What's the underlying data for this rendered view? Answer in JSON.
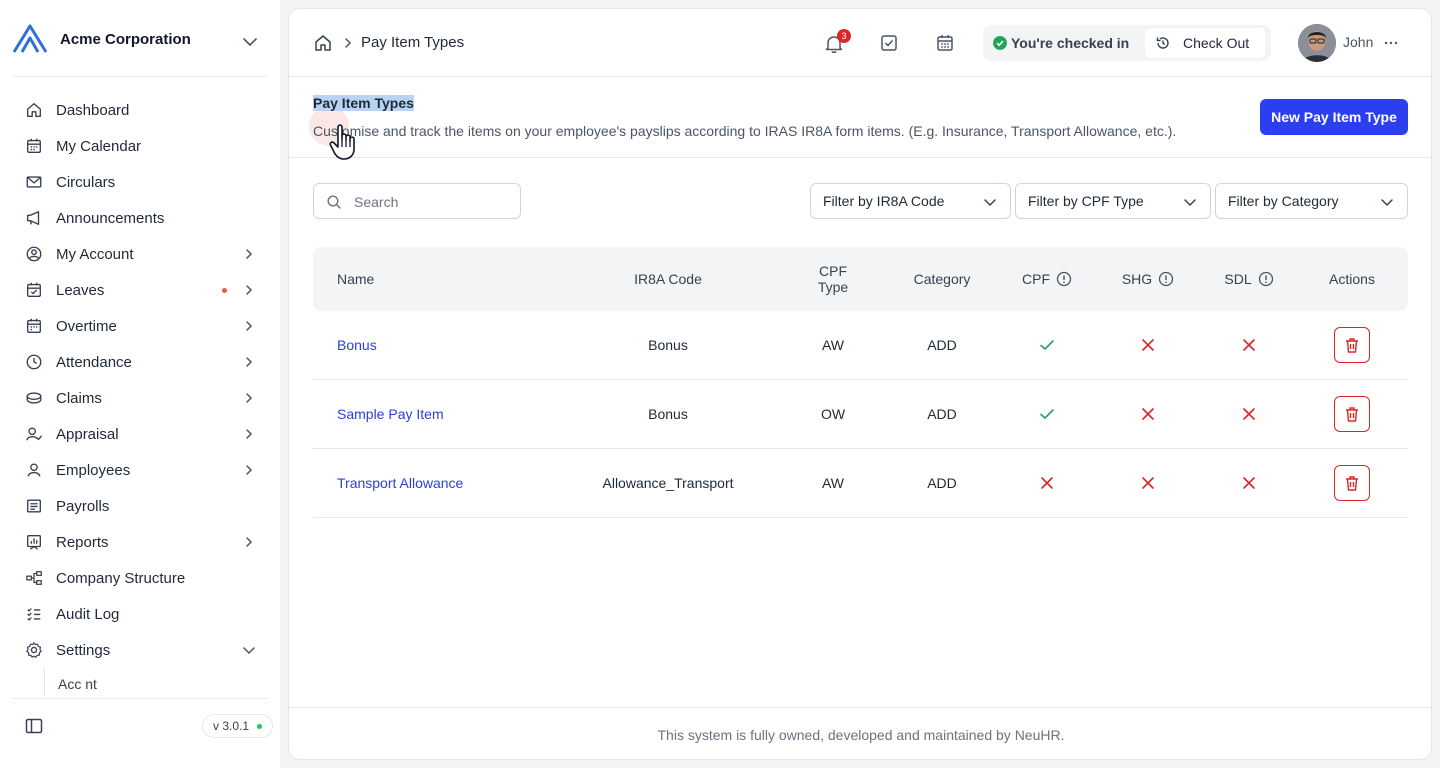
{
  "brand": {
    "name": "Acme Corporation",
    "icons": [
      "logo-icon",
      "chevron-down-icon"
    ]
  },
  "sidebar": {
    "items": [
      {
        "label": "Dashboard",
        "icon": "home-icon",
        "chevron": false
      },
      {
        "label": "My Calendar",
        "icon": "calendar-icon",
        "chevron": false
      },
      {
        "label": "Circulars",
        "icon": "mail-icon",
        "chevron": false
      },
      {
        "label": "Announcements",
        "icon": "megaphone-icon",
        "chevron": false
      },
      {
        "label": "My Account",
        "icon": "user-circle-icon",
        "chevron": true
      },
      {
        "label": "Leaves",
        "icon": "calendar-check-icon",
        "chevron": true,
        "dot": true
      },
      {
        "label": "Overtime",
        "icon": "calendar-clock-icon",
        "chevron": true
      },
      {
        "label": "Attendance",
        "icon": "clock-icon",
        "chevron": true
      },
      {
        "label": "Claims",
        "icon": "coins-icon",
        "chevron": true
      },
      {
        "label": "Appraisal",
        "icon": "user-check-icon",
        "chevron": true
      },
      {
        "label": "Employees",
        "icon": "user-icon",
        "chevron": true
      },
      {
        "label": "Payrolls",
        "icon": "receipt-icon",
        "chevron": false
      },
      {
        "label": "Reports",
        "icon": "chart-icon",
        "chevron": true
      },
      {
        "label": "Company Structure",
        "icon": "org-chart-icon",
        "chevron": false
      },
      {
        "label": "Audit Log",
        "icon": "list-check-icon",
        "chevron": false
      },
      {
        "label": "Settings",
        "icon": "gear-icon",
        "chevron": "down"
      }
    ],
    "sub_partial": "Acc nt",
    "version": "v 3.0.1"
  },
  "topbar": {
    "breadcrumb_current": "Pay Item Types",
    "notification_count": "3",
    "checkin_status": "You're checked in",
    "checkout_label": "Check Out",
    "user_name": "John"
  },
  "page": {
    "title": "Pay Item Types",
    "description": "Customise and track the items on your employee's payslips according to IRAS IR8A form items. (E.g. Insurance, Transport Allowance, etc.).",
    "new_button": "New Pay Item Type"
  },
  "filters": {
    "search_placeholder": "Search",
    "ir8a": "Filter by IR8A Code",
    "cpf": "Filter by CPF Type",
    "category": "Filter by Category"
  },
  "table": {
    "headers": {
      "name": "Name",
      "ir8a": "IR8A Code",
      "cpf_type_1": "CPF",
      "cpf_type_2": "Type",
      "category": "Category",
      "cpf": "CPF",
      "shg": "SHG",
      "sdl": "SDL",
      "actions": "Actions"
    },
    "rows": [
      {
        "name": "Bonus",
        "ir8a": "Bonus",
        "cpf_type": "AW",
        "category": "ADD",
        "cpf": true,
        "shg": false,
        "sdl": false
      },
      {
        "name": "Sample Pay Item",
        "ir8a": "Bonus",
        "cpf_type": "OW",
        "category": "ADD",
        "cpf": true,
        "shg": false,
        "sdl": false
      },
      {
        "name": "Transport Allowance",
        "ir8a": "Allowance_Transport",
        "cpf_type": "AW",
        "category": "ADD",
        "cpf": false,
        "shg": false,
        "sdl": false
      }
    ]
  },
  "footer": {
    "text": "This system is fully owned, developed and maintained by NeuHR."
  },
  "colors": {
    "accent": "#2b3ff0",
    "link": "#2b3fd6",
    "success": "#22a35a",
    "danger": "#dc2626"
  }
}
